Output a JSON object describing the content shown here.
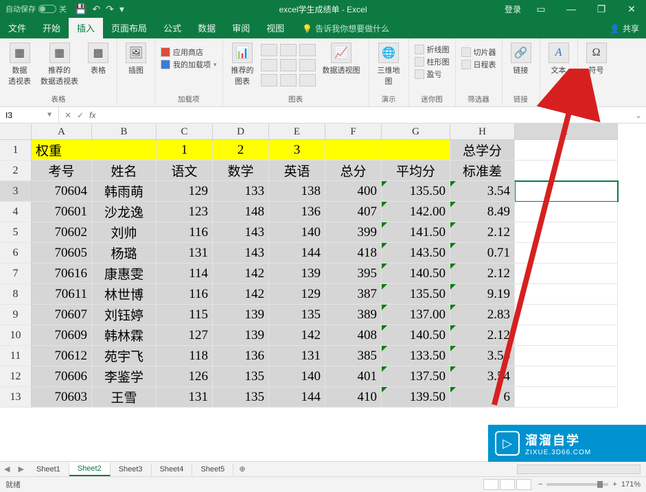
{
  "titlebar": {
    "autosave_label": "自动保存",
    "autosave_state": "关",
    "title": "excel学生成绩单 - Excel",
    "login": "登录",
    "qat": {
      "save": "💾",
      "undo": "↶",
      "redo": "↷",
      "more": "▾"
    }
  },
  "menubar": {
    "tabs": [
      "文件",
      "开始",
      "插入",
      "页面布局",
      "公式",
      "数据",
      "审阅",
      "视图"
    ],
    "active_index": 2,
    "tell_me": "告诉我你想要做什么",
    "share": "共享"
  },
  "ribbon": {
    "groups": {
      "tables": {
        "label": "表格",
        "pivot": "数据\n透视表",
        "rec_pivot": "推荐的\n数据透视表",
        "table": "表格"
      },
      "illus": {
        "label": "插图",
        "btn": "插图"
      },
      "addins": {
        "label": "加载项",
        "store": "应用商店",
        "myaddins": "我的加载项"
      },
      "charts": {
        "label": "图表",
        "rec": "推荐的\n图表",
        "pivotchart": "数据透视图"
      },
      "tours": {
        "label": "演示",
        "map": "三维地\n图"
      },
      "sparklines": {
        "label": "迷你图",
        "line": "折线图",
        "column": "柱形图",
        "winloss": "盈亏"
      },
      "filters": {
        "label": "筛选器",
        "slicer": "切片器",
        "timeline": "日程表"
      },
      "links": {
        "label": "链接",
        "link": "链接"
      },
      "text": {
        "label": "",
        "text": "文本"
      },
      "symbols": {
        "label": "",
        "symbol": "符号"
      }
    }
  },
  "formula_bar": {
    "namebox": "I3",
    "cancel": "✕",
    "enter": "✓",
    "fx": "fx",
    "value": ""
  },
  "grid": {
    "columns": [
      "A",
      "B",
      "C",
      "D",
      "E",
      "F",
      "G",
      "H",
      "I"
    ],
    "selected_cell": "I3",
    "row1": {
      "A": "权重",
      "C": "1",
      "D": "2",
      "E": "3",
      "H": "总学分"
    },
    "headers": [
      "考号",
      "姓名",
      "语文",
      "数学",
      "英语",
      "总分",
      "平均分",
      "标准差"
    ],
    "data": [
      {
        "id": "70604",
        "name": "韩雨萌",
        "c": 129,
        "d": 133,
        "e": 138,
        "f": 400,
        "g": "135.50",
        "h": "3.54"
      },
      {
        "id": "70601",
        "name": "沙龙逸",
        "c": 123,
        "d": 148,
        "e": 136,
        "f": 407,
        "g": "142.00",
        "h": "8.49"
      },
      {
        "id": "70602",
        "name": "刘帅",
        "c": 116,
        "d": 143,
        "e": 140,
        "f": 399,
        "g": "141.50",
        "h": "2.12"
      },
      {
        "id": "70605",
        "name": "杨璐",
        "c": 131,
        "d": 143,
        "e": 144,
        "f": 418,
        "g": "143.50",
        "h": "0.71"
      },
      {
        "id": "70616",
        "name": "康惠雯",
        "c": 114,
        "d": 142,
        "e": 139,
        "f": 395,
        "g": "140.50",
        "h": "2.12"
      },
      {
        "id": "70611",
        "name": "林世博",
        "c": 116,
        "d": 142,
        "e": 129,
        "f": 387,
        "g": "135.50",
        "h": "9.19"
      },
      {
        "id": "70607",
        "name": "刘钰婷",
        "c": 115,
        "d": 139,
        "e": 135,
        "f": 389,
        "g": "137.00",
        "h": "2.83"
      },
      {
        "id": "70609",
        "name": "韩林霖",
        "c": 127,
        "d": 139,
        "e": 142,
        "f": 408,
        "g": "140.50",
        "h": "2.12"
      },
      {
        "id": "70612",
        "name": "苑宇飞",
        "c": 118,
        "d": 136,
        "e": 131,
        "f": 385,
        "g": "133.50",
        "h": "3.54"
      },
      {
        "id": "70606",
        "name": "李鉴学",
        "c": 126,
        "d": 135,
        "e": 140,
        "f": 401,
        "g": "137.50",
        "h": "3.54"
      },
      {
        "id": "70603",
        "name": "王雪",
        "c": 131,
        "d": 135,
        "e": 144,
        "f": 410,
        "g": "139.50",
        "h": "6"
      }
    ]
  },
  "sheet_tabs": {
    "sheets": [
      "Sheet1",
      "Sheet2",
      "Sheet3",
      "Sheet4",
      "Sheet5"
    ],
    "active_index": 1
  },
  "statusbar": {
    "ready": "就绪",
    "zoom": "171%"
  },
  "watermark": {
    "cn": "溜溜自学",
    "en": "ZIXUE.3D66.COM"
  }
}
